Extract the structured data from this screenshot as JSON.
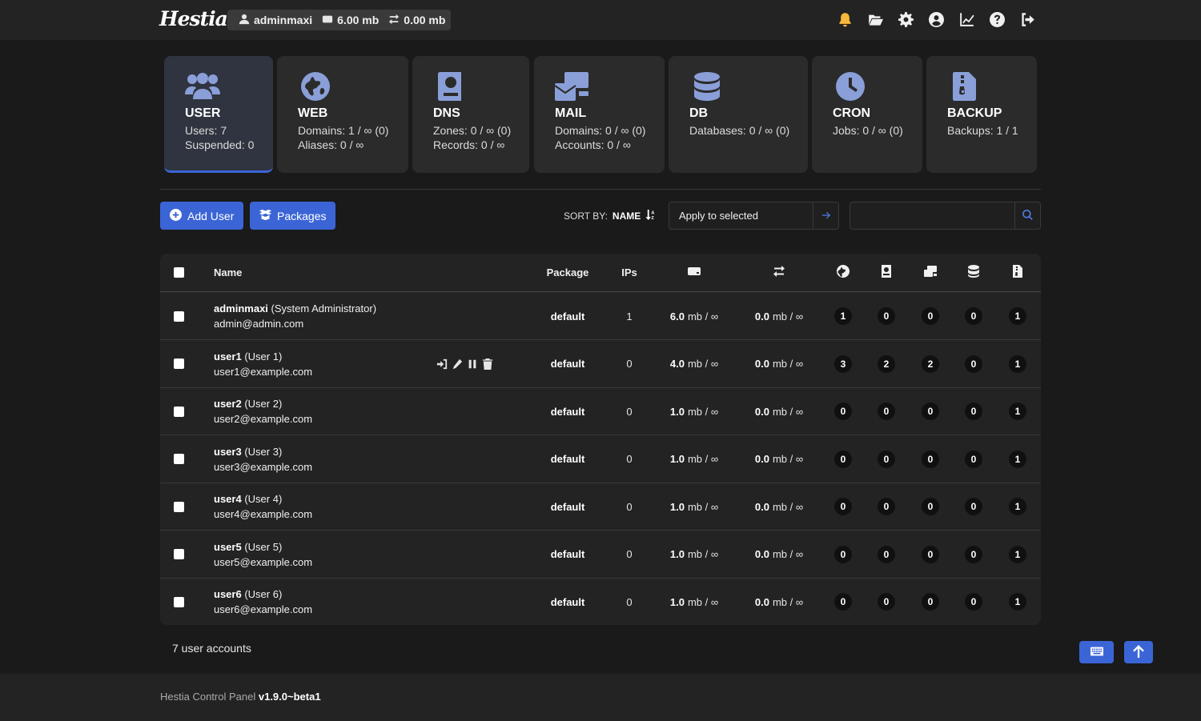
{
  "app": {
    "logo": "Hestia"
  },
  "usage": {
    "user": "adminmaxi",
    "disk": "6.00 mb",
    "bandwidth": "0.00 mb"
  },
  "top_icons": [
    "bell-icon",
    "folder-open-icon",
    "gear-icon",
    "user-circle-icon",
    "chart-line-icon",
    "question-circle-icon",
    "logout-icon"
  ],
  "cards": [
    {
      "title": "USER",
      "lines": [
        "Users: 7",
        "Suspended: 0"
      ],
      "icon": "users-icon",
      "active": true
    },
    {
      "title": "WEB",
      "lines": [
        "Domains: 1 / ∞ (0)",
        "Aliases: 0 / ∞"
      ],
      "icon": "globe-icon"
    },
    {
      "title": "DNS",
      "lines": [
        "Zones: 0 / ∞ (0)",
        "Records: 0 / ∞"
      ],
      "icon": "address-book-icon"
    },
    {
      "title": "MAIL",
      "lines": [
        "Domains: 0 / ∞ (0)",
        "Accounts: 0 / ∞"
      ],
      "icon": "mail-bulk-icon"
    },
    {
      "title": "DB",
      "lines": [
        "Databases: 0 / ∞ (0)"
      ],
      "icon": "database-icon"
    },
    {
      "title": "CRON",
      "lines": [
        "Jobs: 0 / ∞ (0)"
      ],
      "icon": "clock-icon"
    },
    {
      "title": "BACKUP",
      "lines": [
        "Backups: 1 / 1"
      ],
      "icon": "file-zipper-icon"
    }
  ],
  "toolbar": {
    "add_user": "Add User",
    "packages": "Packages",
    "sort_label": "SORT BY:",
    "sort_value": "NAME",
    "bulk_value": "Apply to selected",
    "search_placeholder": ""
  },
  "table": {
    "headers": {
      "name": "Name",
      "package": "Package",
      "ips": "IPs"
    },
    "rows": [
      {
        "user": "adminmaxi",
        "display": "(System Administrator)",
        "email": "admin@admin.com",
        "package": "default",
        "ips": "1",
        "disk_used": "6.0",
        "disk_rest": "mb / ∞",
        "bw_used": "0.0",
        "bw_rest": "mb / ∞",
        "web": "1",
        "dns": "0",
        "mail": "0",
        "db": "0",
        "backups": "1"
      },
      {
        "user": "user1",
        "display": "(User 1)",
        "email": "user1@example.com",
        "package": "default",
        "ips": "0",
        "disk_used": "4.0",
        "disk_rest": "mb / ∞",
        "bw_used": "0.0",
        "bw_rest": "mb / ∞",
        "web": "3",
        "dns": "2",
        "mail": "2",
        "db": "0",
        "backups": "1"
      },
      {
        "user": "user2",
        "display": "(User 2)",
        "email": "user2@example.com",
        "package": "default",
        "ips": "0",
        "disk_used": "1.0",
        "disk_rest": "mb / ∞",
        "bw_used": "0.0",
        "bw_rest": "mb / ∞",
        "web": "0",
        "dns": "0",
        "mail": "0",
        "db": "0",
        "backups": "1"
      },
      {
        "user": "user3",
        "display": "(User 3)",
        "email": "user3@example.com",
        "package": "default",
        "ips": "0",
        "disk_used": "1.0",
        "disk_rest": "mb / ∞",
        "bw_used": "0.0",
        "bw_rest": "mb / ∞",
        "web": "0",
        "dns": "0",
        "mail": "0",
        "db": "0",
        "backups": "1"
      },
      {
        "user": "user4",
        "display": "(User 4)",
        "email": "user4@example.com",
        "package": "default",
        "ips": "0",
        "disk_used": "1.0",
        "disk_rest": "mb / ∞",
        "bw_used": "0.0",
        "bw_rest": "mb / ∞",
        "web": "0",
        "dns": "0",
        "mail": "0",
        "db": "0",
        "backups": "1"
      },
      {
        "user": "user5",
        "display": "(User 5)",
        "email": "user5@example.com",
        "package": "default",
        "ips": "0",
        "disk_used": "1.0",
        "disk_rest": "mb / ∞",
        "bw_used": "0.0",
        "bw_rest": "mb / ∞",
        "web": "0",
        "dns": "0",
        "mail": "0",
        "db": "0",
        "backups": "1"
      },
      {
        "user": "user6",
        "display": "(User 6)",
        "email": "user6@example.com",
        "package": "default",
        "ips": "0",
        "disk_used": "1.0",
        "disk_rest": "mb / ∞",
        "bw_used": "0.0",
        "bw_rest": "mb / ∞",
        "web": "0",
        "dns": "0",
        "mail": "0",
        "db": "0",
        "backups": "1"
      }
    ]
  },
  "count_text": "7 user accounts",
  "footer": {
    "label": "Hestia Control Panel",
    "version": "v1.9.0~beta1"
  },
  "colors": {
    "accent": "#3b65d6",
    "card_icon": "#8a9fd8",
    "notification": "#f6b93b",
    "background": "#1a1a1a"
  }
}
